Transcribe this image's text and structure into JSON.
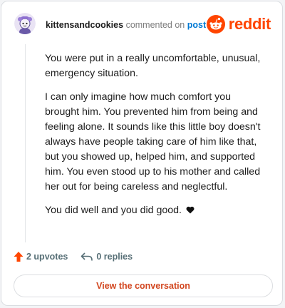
{
  "comment": {
    "username": "kittensandcookies",
    "action_text": "commented on",
    "target_text": "post",
    "brand_name": "reddit",
    "paragraphs": [
      "You were put in a really uncomfortable, unusual, emergency situation.",
      "I can only imagine how much comfort you brought him. You prevented him from being and feeling alone. It sounds like this little boy doesn't always have people taking care of him like that, but you showed up, helped him, and supported him. You even stood up to his mother and called her out for being careless and neglectful.",
      "You did well and you did good."
    ],
    "upvotes_label": "2 upvotes",
    "replies_label": "0 replies",
    "view_button_label": "View the conversation"
  },
  "colors": {
    "brand": "#ff4500",
    "link": "#0079d3",
    "button_text": "#d2461f"
  },
  "icons": [
    "avatar-icon",
    "reddit-logo-icon",
    "heart-icon",
    "upvote-arrow-icon",
    "reply-arrow-icon"
  ]
}
